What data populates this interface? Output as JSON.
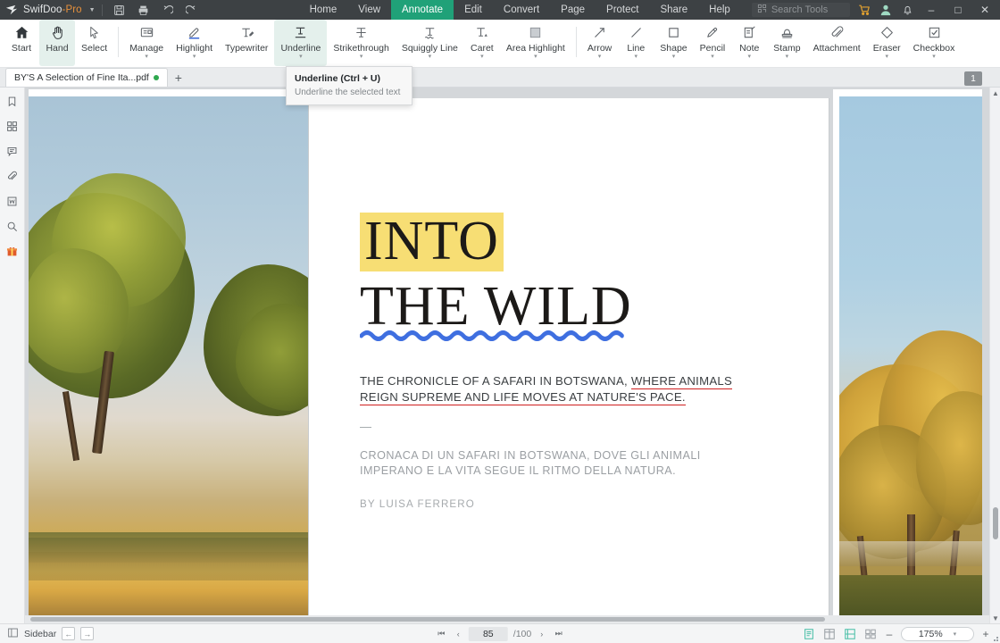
{
  "app": {
    "brand_name": "SwifDoo",
    "brand_suffix": "-Pro",
    "quick_actions": [
      "save-icon",
      "print-icon",
      "undo-icon",
      "redo-icon"
    ]
  },
  "menu": {
    "items": [
      {
        "label": "Home",
        "active": false
      },
      {
        "label": "View",
        "active": false
      },
      {
        "label": "Annotate",
        "active": true
      },
      {
        "label": "Edit",
        "active": false
      },
      {
        "label": "Convert",
        "active": false
      },
      {
        "label": "Page",
        "active": false
      },
      {
        "label": "Protect",
        "active": false
      },
      {
        "label": "Share",
        "active": false
      },
      {
        "label": "Help",
        "active": false
      }
    ],
    "active_color": "#20a178"
  },
  "search": {
    "placeholder": "Search Tools"
  },
  "titlebar_right": {
    "cart_icon": "shopping-cart-icon",
    "account_icon": "user-avatar-icon",
    "bell_icon": "notification-bell-icon",
    "minimize": "–",
    "maximize": "□",
    "close": "✕"
  },
  "ribbon": {
    "tools": [
      {
        "label": "Start",
        "icon": "home-icon",
        "selected": false,
        "has_arrow": false
      },
      {
        "label": "Hand",
        "icon": "hand-icon",
        "selected": true,
        "has_arrow": false
      },
      {
        "label": "Select",
        "icon": "cursor-arrow-icon",
        "selected": false,
        "has_arrow": false
      },
      {
        "divider": true
      },
      {
        "label": "Manage",
        "icon": "manage-notes-icon",
        "selected": false,
        "has_arrow": true
      },
      {
        "label": "Highlight",
        "icon": "highlighter-icon",
        "selected": false,
        "has_arrow": true
      },
      {
        "label": "Typewriter",
        "icon": "typewriter-icon",
        "selected": false,
        "has_arrow": false
      },
      {
        "label": "Underline",
        "icon": "underline-icon",
        "selected": true,
        "has_arrow": true
      },
      {
        "label": "Strikethrough",
        "icon": "strikethrough-icon",
        "selected": false,
        "has_arrow": true
      },
      {
        "label": "Squiggly Line",
        "icon": "squiggly-line-icon",
        "selected": false,
        "has_arrow": true
      },
      {
        "label": "Caret",
        "icon": "caret-icon",
        "selected": false,
        "has_arrow": true
      },
      {
        "label": "Area Highlight",
        "icon": "area-highlight-icon",
        "selected": false,
        "has_arrow": true
      },
      {
        "divider": true
      },
      {
        "label": "Arrow",
        "icon": "arrow-icon",
        "selected": false,
        "has_arrow": true
      },
      {
        "label": "Line",
        "icon": "line-icon",
        "selected": false,
        "has_arrow": true
      },
      {
        "label": "Shape",
        "icon": "shape-square-icon",
        "selected": false,
        "has_arrow": true
      },
      {
        "label": "Pencil",
        "icon": "pencil-icon",
        "selected": false,
        "has_arrow": true
      },
      {
        "label": "Note",
        "icon": "sticky-note-icon",
        "selected": false,
        "has_arrow": true
      },
      {
        "label": "Stamp",
        "icon": "stamp-icon",
        "selected": false,
        "has_arrow": true
      },
      {
        "label": "Attachment",
        "icon": "paperclip-icon",
        "selected": false,
        "has_arrow": false
      },
      {
        "label": "Eraser",
        "icon": "eraser-icon",
        "selected": false,
        "has_arrow": true
      },
      {
        "label": "Checkbox",
        "icon": "checkbox-icon",
        "selected": false,
        "has_arrow": true
      }
    ],
    "selected_bg": "#e4f0ec"
  },
  "tabs": {
    "documents": [
      {
        "title": "BY'S A Selection of Fine Ita...pdf",
        "modified": true
      }
    ],
    "new_tab_label": "+"
  },
  "tooltip": {
    "title": "Underline (Ctrl + U)",
    "description": "Underline the selected text"
  },
  "left_rail": {
    "items": [
      {
        "icon": "bookmark-icon",
        "name": "bookmarks-panel"
      },
      {
        "icon": "thumbnails-icon",
        "name": "page-thumbnails-panel"
      },
      {
        "icon": "comment-icon",
        "name": "comments-panel"
      },
      {
        "icon": "attachment-icon",
        "name": "attachments-panel"
      },
      {
        "icon": "word-icon",
        "name": "word-convert-panel"
      },
      {
        "icon": "search-icon",
        "name": "search-panel"
      },
      {
        "icon": "gift-icon",
        "name": "gift-panel"
      }
    ]
  },
  "document": {
    "page_badge": "1",
    "title_highlighted": "INTO",
    "title_second_line": "THE WILD",
    "highlight_color": "#f7de74",
    "squiggly_color": "#3f6fe0",
    "underline_color": "#d01f1f",
    "deck_line1_plain": "THE CHRONICLE OF A SAFARI IN BOTSWANA, ",
    "deck_line1_underlined": "WHERE ANIMALS",
    "deck_line2_underlined": "REIGN SUPREME AND LIFE MOVES AT NATURE'S PACE.",
    "separator_dash": "—",
    "italian_line1": "CRONACA DI UN SAFARI IN BOTSWANA, DOVE GLI ANIMALI",
    "italian_line2": "IMPERANO E LA VITA SEGUE IL RITMO DELLA NATURA.",
    "byline": "BY LUISA FERRERO",
    "left_photo_alt": "savanna-trees-photo",
    "right_photo_alt": "golden-acacia-trees-photo"
  },
  "status": {
    "sidebar_label": "Sidebar",
    "nav_back": "←",
    "nav_forward": "→",
    "first_page": "⏮",
    "prev_page": "‹",
    "current_page": "85",
    "total_pages": "/100",
    "next_page": "›",
    "last_page": "⏭",
    "view_modes": [
      {
        "icon": "single-page-view-icon",
        "active": true
      },
      {
        "icon": "two-page-view-icon",
        "active": false
      },
      {
        "icon": "continuous-scroll-icon",
        "active": true
      },
      {
        "icon": "grid-view-icon",
        "active": false
      }
    ],
    "zoom_out": "–",
    "zoom_level": "175%",
    "zoom_dropdown": "▾",
    "zoom_in": "+",
    "active_color": "#4cc0a8"
  }
}
